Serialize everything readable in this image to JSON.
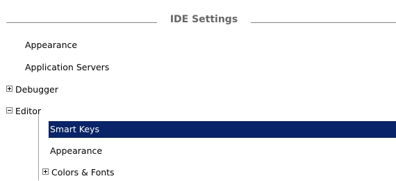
{
  "section": {
    "title": "IDE Settings"
  },
  "tree": {
    "items": [
      {
        "label": "Appearance",
        "expand_state": "none"
      },
      {
        "label": "Application Servers",
        "expand_state": "none"
      },
      {
        "label": "Debugger",
        "expand_state": "collapsed"
      },
      {
        "label": "Editor",
        "expand_state": "expanded"
      },
      {
        "label": "Smart Keys",
        "expand_state": "none",
        "selected": true
      },
      {
        "label": "Appearance",
        "expand_state": "none"
      },
      {
        "label": "Colors & Fonts",
        "expand_state": "collapsed"
      }
    ]
  },
  "colors": {
    "selection_background": "#0a246a",
    "selection_text": "#ffffff",
    "header_text": "#666666",
    "separator": "#808080"
  },
  "icons": {
    "expand": "plus-box-icon",
    "collapse": "minus-box-icon"
  }
}
